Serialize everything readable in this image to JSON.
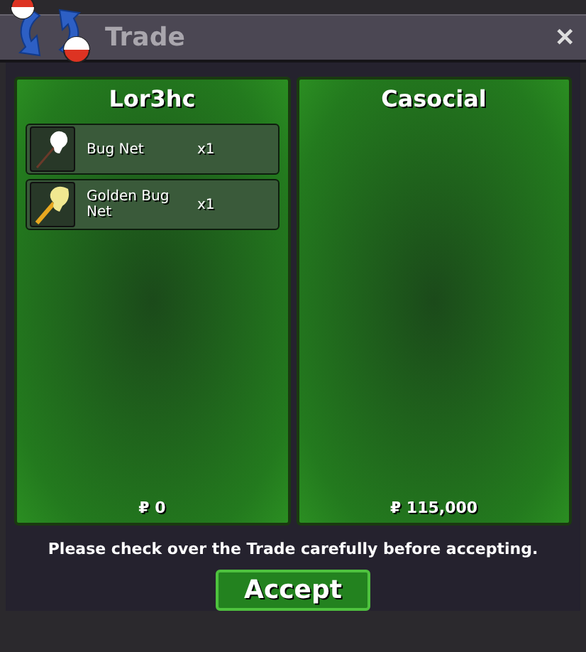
{
  "window": {
    "title": "Trade",
    "close": "✕"
  },
  "panels": [
    {
      "name": "Lor3hc",
      "items": [
        {
          "name": "Bug Net",
          "quantity": "x1",
          "kind": "net"
        },
        {
          "name": "Golden Bug Net",
          "quantity": "x1",
          "kind": "golden-net"
        }
      ],
      "money": "₽ 0"
    },
    {
      "name": "Casocial",
      "money": "₽ 115,000"
    }
  ],
  "notice": "Please check over the Trade carefully before accepting.",
  "button": "Accept"
}
